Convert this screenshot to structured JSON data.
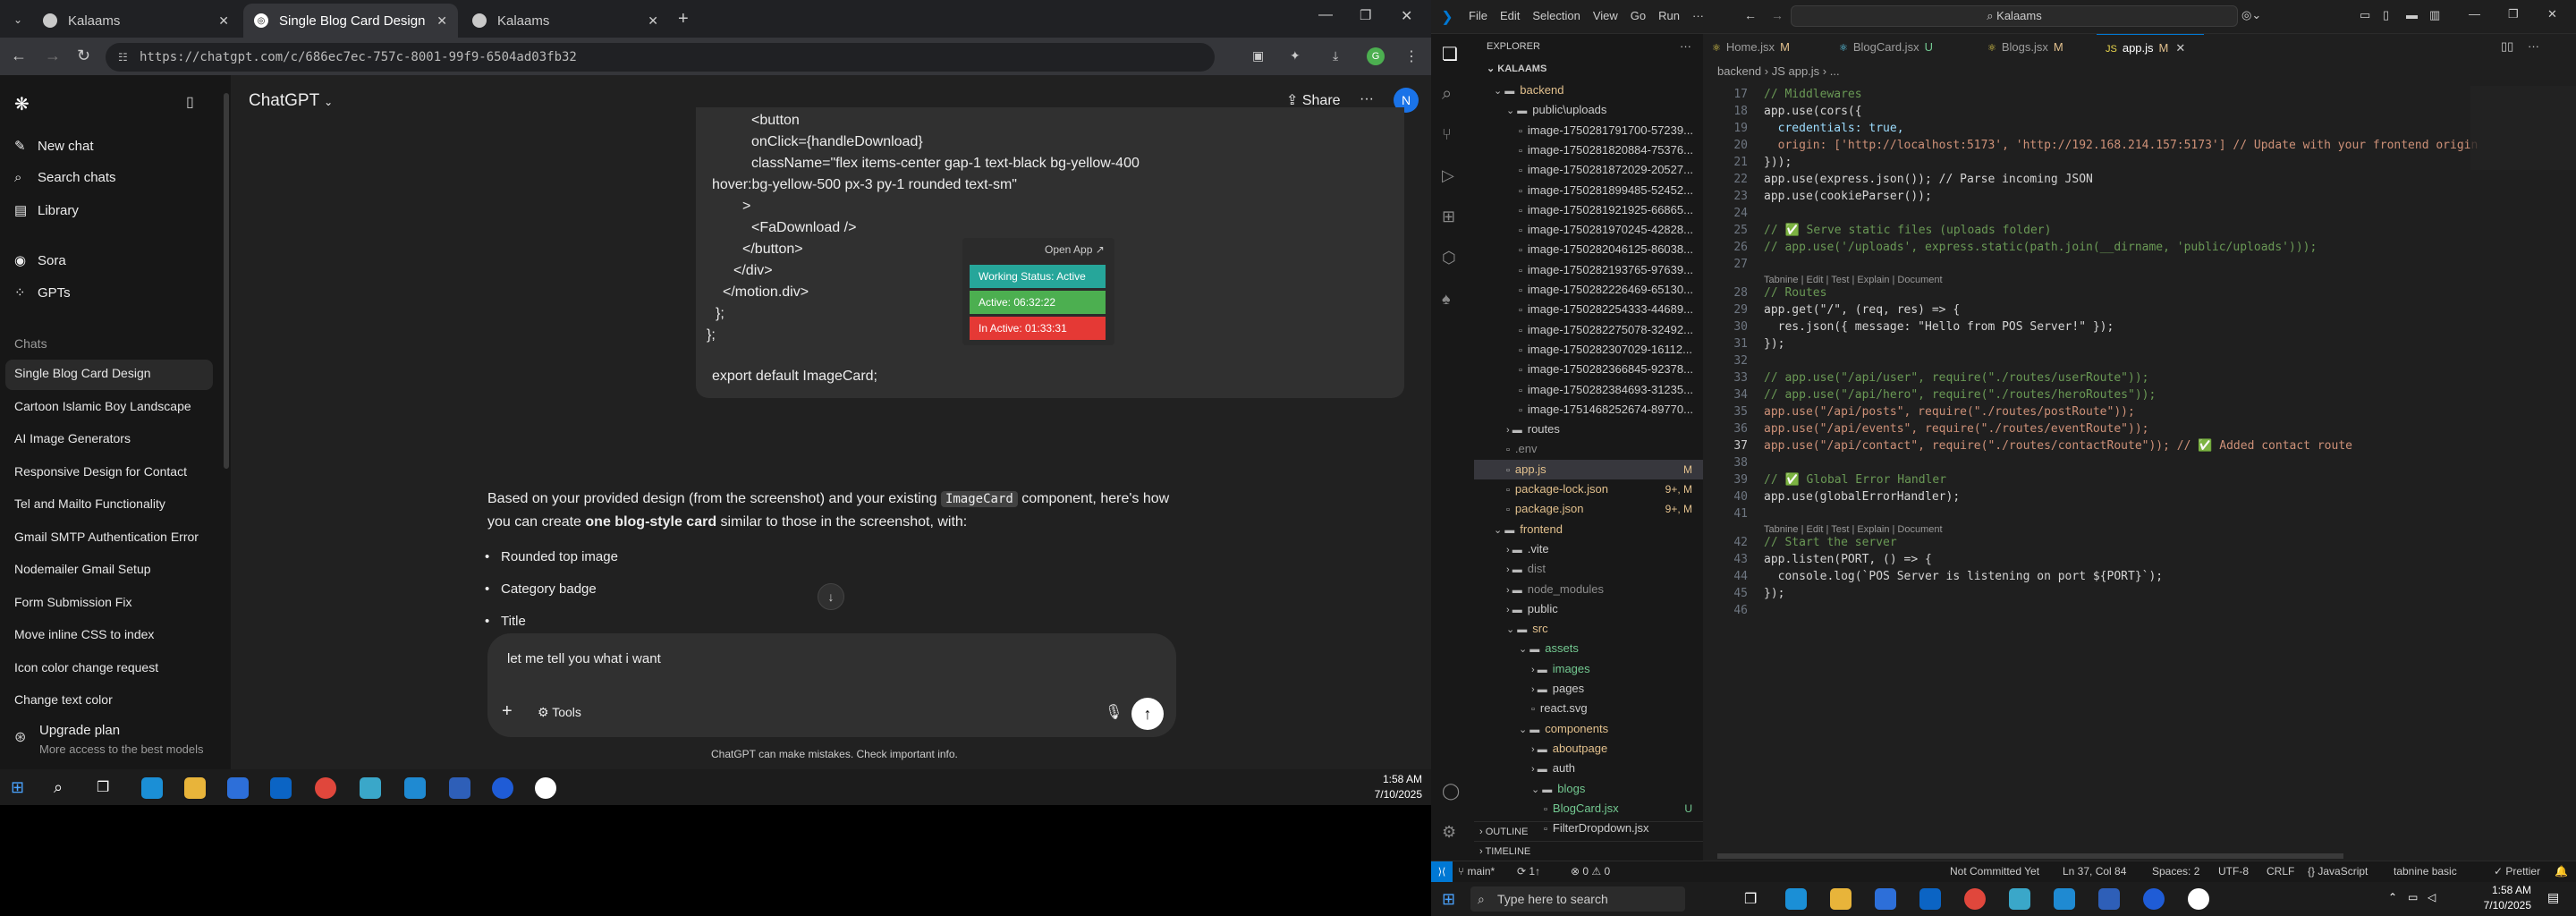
{
  "browser": {
    "tabs": [
      {
        "label": "Kalaams",
        "active": false
      },
      {
        "label": "Single Blog Card Design",
        "active": true
      },
      {
        "label": "Kalaams",
        "active": false
      }
    ],
    "url": "https://chatgpt.com/c/686ec7ec-757c-8001-99f9-6504ad03fb32"
  },
  "chatgpt": {
    "brand": "ChatGPT",
    "share_label": "Share",
    "avatar_letter": "N",
    "sidebar": {
      "primary": [
        "New chat",
        "Search chats",
        "Library"
      ],
      "secondary": [
        "Sora",
        "GPTs"
      ],
      "chats_header": "Chats",
      "chats": [
        "Single Blog Card Design",
        "Cartoon Islamic Boy Landscape",
        "AI Image Generators",
        "Responsive Design for Contact",
        "Tel and Mailto Functionality",
        "Gmail SMTP Authentication Error",
        "Nodemailer Gmail Setup",
        "Form Submission Fix",
        "Move inline CSS to index",
        "Icon color change request",
        "Change text color"
      ],
      "upgrade_title": "Upgrade plan",
      "upgrade_sub": "More access to the best models"
    },
    "code_lines": [
      "<button",
      "onClick={handleDownload}",
      "className=\"flex items-center gap-1 text-black bg-yellow-400",
      "hover:bg-yellow-500 px-3 py-1 rounded text-sm\"",
      ">",
      "<FaDownload />",
      "</button>",
      "</div>",
      "</motion.div>",
      "};",
      "};",
      "export default ImageCard;"
    ],
    "popup": {
      "open_app": "Open App ↗",
      "working": "Working Status: Active",
      "active": "Active: 06:32:22",
      "inactive": "In Active: 01:33:31"
    },
    "answer_pre": "Based on your provided design (from the screenshot) and your existing ",
    "answer_code": "ImageCard",
    "answer_mid": " component, here's how you can create ",
    "answer_bold": "one blog-style card",
    "answer_post": " similar to those in the screenshot, with:",
    "bullets": [
      "Rounded top image",
      "Category badge",
      "Title"
    ],
    "composer_text": "let me tell you what i want",
    "tools_label": "Tools",
    "disclaimer": "ChatGPT can make mistakes. Check important info."
  },
  "taskbar_left": {
    "time": "1:58 AM",
    "date": "7/10/2025"
  },
  "vscode": {
    "menu": [
      "File",
      "Edit",
      "Selection",
      "View",
      "Go",
      "Run",
      "···"
    ],
    "search": "Kalaams",
    "explorer_title": "EXPLORER",
    "project": "KALAAMS",
    "tabs": [
      {
        "label": "Home.jsx",
        "badge": "M",
        "active": false
      },
      {
        "label": "BlogCard.jsx",
        "badge": "U",
        "active": false
      },
      {
        "label": "Blogs.jsx",
        "badge": "M",
        "active": false
      },
      {
        "label": "app.js",
        "badge": "M",
        "active": true
      }
    ],
    "breadcrumb": "backend  ›  JS app.js  ›  ...",
    "tree": [
      {
        "label": "backend",
        "depth": 1,
        "type": "folder-open",
        "badge": "",
        "color": "#e2c08d"
      },
      {
        "label": "public\\uploads",
        "depth": 2,
        "type": "folder-open",
        "badge": "",
        "color": "#cccccc"
      },
      {
        "label": "image-1750281791700-57239...",
        "depth": 3,
        "type": "file",
        "badge": "",
        "color": "#cccccc"
      },
      {
        "label": "image-1750281820884-75376...",
        "depth": 3,
        "type": "file",
        "badge": "",
        "color": "#cccccc"
      },
      {
        "label": "image-1750281872029-20527...",
        "depth": 3,
        "type": "file",
        "badge": "",
        "color": "#cccccc"
      },
      {
        "label": "image-1750281899485-52452...",
        "depth": 3,
        "type": "file",
        "badge": "",
        "color": "#cccccc"
      },
      {
        "label": "image-1750281921925-66865...",
        "depth": 3,
        "type": "file",
        "badge": "",
        "color": "#cccccc"
      },
      {
        "label": "image-1750281970245-42828...",
        "depth": 3,
        "type": "file",
        "badge": "",
        "color": "#cccccc"
      },
      {
        "label": "image-1750282046125-86038...",
        "depth": 3,
        "type": "file",
        "badge": "",
        "color": "#cccccc"
      },
      {
        "label": "image-1750282193765-97639...",
        "depth": 3,
        "type": "file",
        "badge": "",
        "color": "#cccccc"
      },
      {
        "label": "image-1750282226469-65130...",
        "depth": 3,
        "type": "file",
        "badge": "",
        "color": "#cccccc"
      },
      {
        "label": "image-1750282254333-44689...",
        "depth": 3,
        "type": "file",
        "badge": "",
        "color": "#cccccc"
      },
      {
        "label": "image-1750282275078-32492...",
        "depth": 3,
        "type": "file",
        "badge": "",
        "color": "#cccccc"
      },
      {
        "label": "image-1750282307029-16112...",
        "depth": 3,
        "type": "file",
        "badge": "",
        "color": "#cccccc"
      },
      {
        "label": "image-1750282366845-92378...",
        "depth": 3,
        "type": "file",
        "badge": "",
        "color": "#cccccc"
      },
      {
        "label": "image-1750282384693-31235...",
        "depth": 3,
        "type": "file",
        "badge": "",
        "color": "#cccccc"
      },
      {
        "label": "image-1751468252674-89770...",
        "depth": 3,
        "type": "file",
        "badge": "",
        "color": "#cccccc"
      },
      {
        "label": "routes",
        "depth": 2,
        "type": "folder",
        "badge": "",
        "color": "#cccccc"
      },
      {
        "label": ".env",
        "depth": 2,
        "type": "file",
        "badge": "",
        "color": "#8c8c8c"
      },
      {
        "label": "app.js",
        "depth": 2,
        "type": "file",
        "badge": "M",
        "color": "#e2c08d",
        "selected": true
      },
      {
        "label": "package-lock.json",
        "depth": 2,
        "type": "file",
        "badge": "9+, M",
        "color": "#e2c08d"
      },
      {
        "label": "package.json",
        "depth": 2,
        "type": "file",
        "badge": "9+, M",
        "color": "#e2c08d"
      },
      {
        "label": "frontend",
        "depth": 1,
        "type": "folder-open",
        "badge": "",
        "color": "#e2c08d"
      },
      {
        "label": ".vite",
        "depth": 2,
        "type": "folder",
        "badge": "",
        "color": "#cccccc"
      },
      {
        "label": "dist",
        "depth": 2,
        "type": "folder",
        "badge": "",
        "color": "#8c8c8c"
      },
      {
        "label": "node_modules",
        "depth": 2,
        "type": "folder",
        "badge": "",
        "color": "#8c8c8c"
      },
      {
        "label": "public",
        "depth": 2,
        "type": "folder",
        "badge": "",
        "color": "#cccccc"
      },
      {
        "label": "src",
        "depth": 2,
        "type": "folder-open",
        "badge": "",
        "color": "#e2c08d"
      },
      {
        "label": "assets",
        "depth": 3,
        "type": "folder-open",
        "badge": "",
        "color": "#73c991"
      },
      {
        "label": "images",
        "depth": 4,
        "type": "folder",
        "badge": "",
        "color": "#73c991"
      },
      {
        "label": "pages",
        "depth": 4,
        "type": "folder",
        "badge": "",
        "color": "#cccccc"
      },
      {
        "label": "react.svg",
        "depth": 4,
        "type": "file",
        "badge": "",
        "color": "#cccccc"
      },
      {
        "label": "components",
        "depth": 3,
        "type": "folder-open",
        "badge": "",
        "color": "#e2c08d"
      },
      {
        "label": "aboutpage",
        "depth": 4,
        "type": "folder",
        "badge": "",
        "color": "#e2c08d"
      },
      {
        "label": "auth",
        "depth": 4,
        "type": "folder",
        "badge": "",
        "color": "#cccccc"
      },
      {
        "label": "blogs",
        "depth": 4,
        "type": "folder-open",
        "badge": "",
        "color": "#73c991"
      },
      {
        "label": "BlogCard.jsx",
        "depth": 5,
        "type": "file",
        "badge": "U",
        "color": "#73c991"
      },
      {
        "label": "FilterDropdown.jsx",
        "depth": 5,
        "type": "file",
        "badge": "",
        "color": "#cccccc"
      }
    ],
    "outline": "OUTLINE",
    "timeline": "TIMELINE",
    "code": [
      {
        "n": "17",
        "t": "// Middlewares",
        "c": "#6a9955"
      },
      {
        "n": "18",
        "t": "app.use(cors({",
        "c": "#d4d4d4"
      },
      {
        "n": "19",
        "t": "  credentials: true,",
        "c": "#9cdcfe"
      },
      {
        "n": "20",
        "t": "  origin: ['http://localhost:5173', 'http://192.168.214.157:5173'] // Update with your frontend origin",
        "c": "#ce9178"
      },
      {
        "n": "21",
        "t": "}));",
        "c": "#d4d4d4"
      },
      {
        "n": "22",
        "t": "app.use(express.json()); // Parse incoming JSON",
        "c": "#d4d4d4"
      },
      {
        "n": "23",
        "t": "app.use(cookieParser());",
        "c": "#d4d4d4"
      },
      {
        "n": "24",
        "t": "",
        "c": "#d4d4d4"
      },
      {
        "n": "25",
        "t": "// ✅ Serve static files (uploads folder)",
        "c": "#6a9955"
      },
      {
        "n": "26",
        "t": "// app.use('/uploads', express.static(path.join(__dirname, 'public/uploads')));",
        "c": "#6a9955"
      },
      {
        "n": "27",
        "t": "",
        "c": "#d4d4d4"
      },
      {
        "n": "28",
        "t": "// Routes",
        "c": "#6a9955",
        "lens": "Tabnine | Edit | Test | Explain | Document"
      },
      {
        "n": "29",
        "t": "app.get(\"/\", (req, res) => {",
        "c": "#d4d4d4"
      },
      {
        "n": "30",
        "t": "  res.json({ message: \"Hello from POS Server!\" });",
        "c": "#d4d4d4"
      },
      {
        "n": "31",
        "t": "});",
        "c": "#d4d4d4"
      },
      {
        "n": "32",
        "t": "",
        "c": "#d4d4d4"
      },
      {
        "n": "33",
        "t": "// app.use(\"/api/user\", require(\"./routes/userRoute\"));",
        "c": "#6a9955"
      },
      {
        "n": "34",
        "t": "// app.use(\"/api/hero\", require(\"./routes/heroRoutes\"));",
        "c": "#6a9955"
      },
      {
        "n": "35",
        "t": "app.use(\"/api/posts\", require(\"./routes/postRoute\"));",
        "c": "#ce9178"
      },
      {
        "n": "36",
        "t": "app.use(\"/api/events\", require(\"./routes/eventRoute\"));",
        "c": "#ce9178"
      },
      {
        "n": "37",
        "t": "app.use(\"/api/contact\", require(\"./routes/contactRoute\")); // ✅ Added contact route",
        "c": "#ce9178"
      },
      {
        "n": "38",
        "t": "",
        "c": "#d4d4d4"
      },
      {
        "n": "39",
        "t": "// ✅ Global Error Handler",
        "c": "#6a9955"
      },
      {
        "n": "40",
        "t": "app.use(globalErrorHandler);",
        "c": "#d4d4d4"
      },
      {
        "n": "41",
        "t": "",
        "c": "#d4d4d4"
      },
      {
        "n": "42",
        "t": "// Start the server",
        "c": "#6a9955",
        "lens": "Tabnine | Edit | Test | Explain | Document"
      },
      {
        "n": "43",
        "t": "app.listen(PORT, () => {",
        "c": "#d4d4d4"
      },
      {
        "n": "44",
        "t": "  console.log(`POS Server is listening on port ${PORT}`);",
        "c": "#d4d4d4"
      },
      {
        "n": "45",
        "t": "});",
        "c": "#d4d4d4"
      },
      {
        "n": "46",
        "t": "",
        "c": "#d4d4d4"
      }
    ],
    "status": {
      "branch": "main*",
      "sync": "⟳ 1↑",
      "problems": "⊗ 0 ⚠ 0",
      "commit": "Not Committed Yet",
      "cursor": "Ln 37, Col 84",
      "spaces": "Spaces: 2",
      "encoding": "UTF-8",
      "eol": "CRLF",
      "language": "{} JavaScript",
      "tabnine": "tabnine basic",
      "prettier": "✓ Prettier"
    }
  },
  "taskbar_right": {
    "search_placeholder": "Type here to search",
    "time": "1:58 AM",
    "date": "7/10/2025"
  },
  "colors": {
    "accent": "#0078d4",
    "status_green": "#4caf50",
    "status_teal": "#26a69a",
    "status_red": "#e53935"
  }
}
